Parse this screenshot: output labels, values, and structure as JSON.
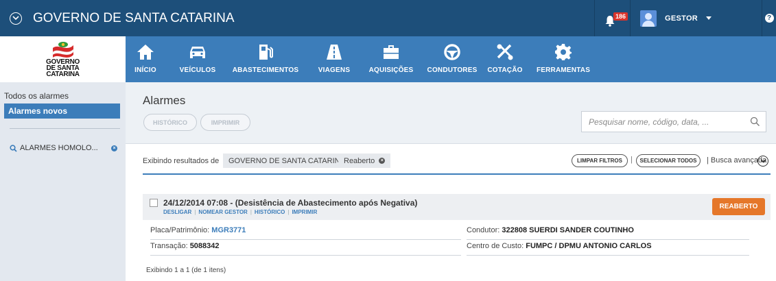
{
  "topbar": {
    "title": "GOVERNO DE SANTA CATARINA",
    "notification_count": "186",
    "user_name": "GESTOR",
    "help": "?"
  },
  "logo": {
    "line1": "GOVERNO",
    "line2": "DE SANTA",
    "line3": "CATARINA"
  },
  "nav": {
    "items": [
      {
        "label": "INÍCIO",
        "icon": "home-icon"
      },
      {
        "label": "VEÍCULOS",
        "icon": "car-icon"
      },
      {
        "label": "ABASTECIMENTOS",
        "icon": "fuel-pump-icon"
      },
      {
        "label": "VIAGENS",
        "icon": "road-icon"
      },
      {
        "label": "AQUISIÇÕES",
        "icon": "briefcase-icon"
      },
      {
        "label": "CONDUTORES",
        "icon": "steering-wheel-icon"
      },
      {
        "label": "COTAÇÃO",
        "icon": "tools-icon"
      },
      {
        "label": "FERRAMENTAS",
        "icon": "gear-icon"
      }
    ]
  },
  "sidebar": {
    "all_alarms": "Todos os alarmes",
    "new_alarms": "Alarmes novos",
    "saved_search": "ALARMES HOMOLO..."
  },
  "main": {
    "title": "Alarmes",
    "btn_history": "HISTÓRICO",
    "btn_print": "IMPRIMIR",
    "search_placeholder": "Pesquisar nome, código, data, ..."
  },
  "filters": {
    "label": "Exibindo resultados de",
    "chip1": "GOVERNO DE SANTA CATARINA",
    "chip2": "Reaberto",
    "clear": "LIMPAR FILTROS",
    "select_all": "SELECIONAR TODOS",
    "advanced": "| Busca avançada"
  },
  "result": {
    "title": "24/12/2014 07:08 - (Desistência de Abastecimento após Negativa)",
    "links": [
      "DESLIGAR",
      "NOMEAR GESTOR",
      "HISTÓRICO",
      "IMPRIMIR"
    ],
    "status_button": "REABERTO",
    "plate_label": "Placa/Patrimônio:",
    "plate_value": "MGR3771",
    "transaction_label": "Transação:",
    "transaction_value": "5088342",
    "driver_label": "Condutor:",
    "driver_value": "322808 SUERDI SANDER COUTINHO",
    "cost_center_label": "Centro de Custo:",
    "cost_center_value": "FUMPC / DPMU ANTONIO CARLOS"
  },
  "footer": {
    "pagination": "Exibindo 1 a 1 (de 1 itens)"
  },
  "colors": {
    "topbar": "#1d4f7a",
    "nav": "#3c7dba",
    "accent_orange": "#e5772a",
    "badge_red": "#d9342b"
  }
}
